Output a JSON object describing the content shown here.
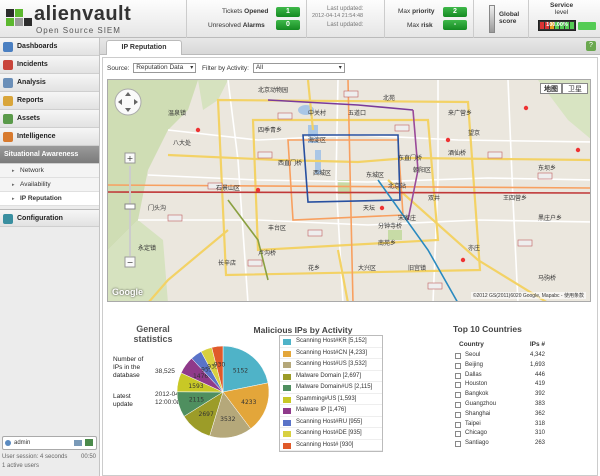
{
  "header": {
    "brand": "alienvault",
    "tagline": "Open Source SIEM",
    "tickets_label_a": "Tickets",
    "tickets_label_b": "Opened",
    "tickets_value": "1",
    "alarms_label_a": "Unresolved",
    "alarms_label_b": "Alarms",
    "alarms_value": "0",
    "last_updated_1": "Last updated:",
    "last_updated_date": "2012-04-14 21:54:48",
    "last_updated_2": "Last updated:",
    "max_priority_label_a": "Max",
    "max_priority_label_b": "priority",
    "max_priority_value": "2",
    "max_risk_label_a": "Max",
    "max_risk_label_b": "risk",
    "max_risk_value": "-",
    "global_score_1": "Global",
    "global_score_2": "score",
    "service_level_1": "Service",
    "service_level_2": "level",
    "service_level_value": "100.00%"
  },
  "sidebar": {
    "items": [
      {
        "label": "Dashboards",
        "color": "#4a7fc1"
      },
      {
        "label": "Incidents",
        "color": "#c9453b"
      },
      {
        "label": "Analysis",
        "color": "#6b8fb8"
      },
      {
        "label": "Reports",
        "color": "#d9a53a"
      },
      {
        "label": "Assets",
        "color": "#5a9a4a"
      },
      {
        "label": "Intelligence",
        "color": "#d87a2e"
      }
    ],
    "active_section": "Situational Awareness",
    "sub_items": [
      "Network",
      "Availability",
      "IP Reputation"
    ],
    "config_label": "Configuration",
    "user": "admin",
    "session_line1": "User session: 4 seconds",
    "session_time": "00:50",
    "session_line2": "1 active users"
  },
  "tab": {
    "label": "IP Reputation",
    "help": "?"
  },
  "filters": {
    "source_label": "Source:",
    "source_value": "Reputation Data",
    "activity_label": "Filter by Activity:",
    "activity_value": "All"
  },
  "map": {
    "type_map": "地图",
    "type_sat": "卫星",
    "google": "Google",
    "copyright": "©2012 GS(2011)6020 Google, Mapabc - 使用条款",
    "places": [
      {
        "t": "北京动物园"
      },
      {
        "t": "海淀区"
      },
      {
        "t": "西城区"
      },
      {
        "t": "东城区"
      },
      {
        "t": "朝阳区"
      },
      {
        "t": "石景山区"
      },
      {
        "t": "丰台区"
      },
      {
        "t": "大兴区"
      },
      {
        "t": "亦庄"
      },
      {
        "t": "门头沟"
      },
      {
        "t": "永定镇"
      },
      {
        "t": "八大处"
      },
      {
        "t": "四季青乡"
      },
      {
        "t": "北苑"
      },
      {
        "t": "来广营乡"
      },
      {
        "t": "望京"
      },
      {
        "t": "酒仙桥"
      },
      {
        "t": "双井"
      },
      {
        "t": "王四营乡"
      },
      {
        "t": "长辛店"
      },
      {
        "t": "南苑乡"
      },
      {
        "t": "旧宫镇"
      },
      {
        "t": "花乡"
      },
      {
        "t": "分钟寺桥"
      },
      {
        "t": "卢沟桥"
      },
      {
        "t": "天坛"
      },
      {
        "t": "北京站"
      },
      {
        "t": "东直门桥"
      },
      {
        "t": "西直门桥"
      },
      {
        "t": "中关村"
      },
      {
        "t": "五道口"
      },
      {
        "t": "温泉镇"
      },
      {
        "t": "东坝乡"
      },
      {
        "t": "黑庄户乡"
      },
      {
        "t": "马驹桥"
      },
      {
        "t": "宋家庄"
      }
    ]
  },
  "stats": {
    "title": "General statistics",
    "ips_label": "Number of IPs in the database",
    "ips_value": "38,525",
    "update_label": "Latest update",
    "update_value": "2012-04-16 12:00:08"
  },
  "malicious": {
    "title": "Malicious IPs by Activity",
    "legend": [
      {
        "label": "Scanning Host#KR [5,152]",
        "color": "#4fb3c8"
      },
      {
        "label": "Scanning Host#CN [4,233]",
        "color": "#e3a63a"
      },
      {
        "label": "Scanning Host#US [3,532]",
        "color": "#b5a87a"
      },
      {
        "label": "Malware Domain [2,697]",
        "color": "#9c9c28"
      },
      {
        "label": "Malware Domain#US [2,115]",
        "color": "#4f8f5f"
      },
      {
        "label": "Spamming#US [1,593]",
        "color": "#c8c826"
      },
      {
        "label": "Malware IP [1,476]",
        "color": "#8f3a8a"
      },
      {
        "label": "Scanning Host#RU [955]",
        "color": "#5a73c8"
      },
      {
        "label": "Scanning Host#DE [935]",
        "color": "#d8d040"
      },
      {
        "label": "Scanning Host# [930]",
        "color": "#e05a2a"
      }
    ]
  },
  "chart_data": {
    "type": "pie",
    "title": "Malicious IPs by Activity",
    "categories": [
      "Scanning Host#KR",
      "Scanning Host#CN",
      "Scanning Host#US",
      "Malware Domain",
      "Malware Domain#US",
      "Spamming#US",
      "Malware IP",
      "Scanning Host#RU",
      "Scanning Host#DE",
      "Scanning Host#"
    ],
    "values": [
      5152,
      4233,
      3532,
      2697,
      2115,
      1593,
      1476,
      955,
      935,
      930
    ],
    "slice_labels": [
      "5152",
      "4233",
      "3532",
      "2697",
      "2115",
      "1593",
      "1476",
      "955",
      "935",
      "930"
    ]
  },
  "top10": {
    "title": "Top 10 Countries",
    "col_country": "Country",
    "col_ips": "IPs #",
    "rows": [
      {
        "country": "Seoul",
        "ips": "4,342"
      },
      {
        "country": "Beijing",
        "ips": "1,693"
      },
      {
        "country": "Dallas",
        "ips": "446"
      },
      {
        "country": "Houston",
        "ips": "419"
      },
      {
        "country": "Bangkok",
        "ips": "392"
      },
      {
        "country": "Guangzhou",
        "ips": "383"
      },
      {
        "country": "Shanghai",
        "ips": "362"
      },
      {
        "country": "Taipei",
        "ips": "318"
      },
      {
        "country": "Chicago",
        "ips": "310"
      },
      {
        "country": "Santiago",
        "ips": "263"
      }
    ]
  }
}
